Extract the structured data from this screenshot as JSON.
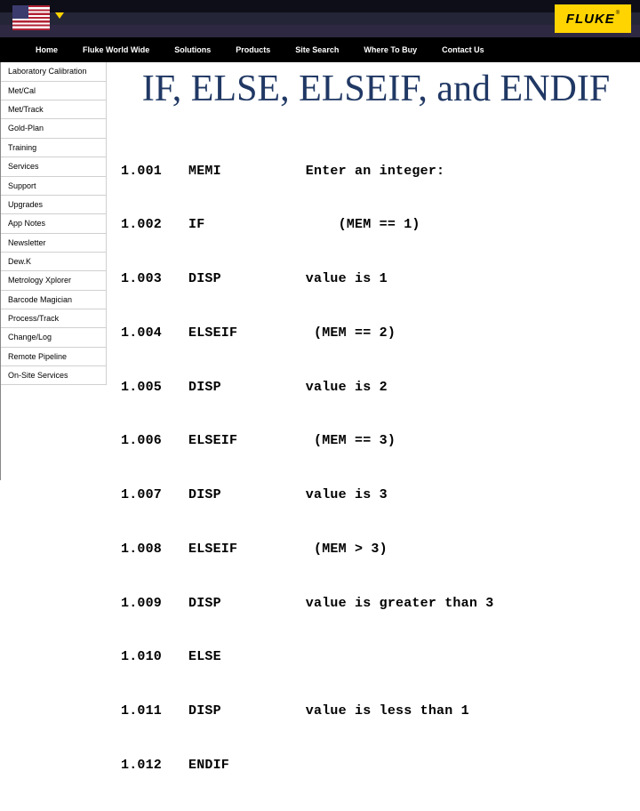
{
  "brand": "FLUKE",
  "nav": [
    "Home",
    "Fluke World Wide",
    "Solutions",
    "Products",
    "Site Search",
    "Where To Buy",
    "Contact Us"
  ],
  "sidebar": [
    "Laboratory Calibration",
    "Met/Cal",
    "Met/Track",
    "Gold-Plan",
    "Training",
    "Services",
    "Support",
    "Upgrades",
    "App Notes",
    "Newsletter",
    "Dew.K",
    "Metrology Xplorer",
    "Barcode Magician",
    "Process/Track",
    "Change/Log",
    "Remote Pipeline",
    "On-Site Services"
  ],
  "title": "IF, ELSE, ELSEIF, and ENDIF",
  "code": [
    {
      "n": "1.001",
      "op": "MEMI",
      "arg": "    Enter an integer:"
    },
    {
      "n": "1.002",
      "op": "IF",
      "arg": "        (MEM == 1)"
    },
    {
      "n": "1.003",
      "op": "DISP",
      "arg": "    value is 1"
    },
    {
      "n": "1.004",
      "op": "ELSEIF",
      "arg": "     (MEM == 2)"
    },
    {
      "n": "1.005",
      "op": "DISP",
      "arg": "    value is 2"
    },
    {
      "n": "1.006",
      "op": "ELSEIF",
      "arg": "     (MEM == 3)"
    },
    {
      "n": "1.007",
      "op": "DISP",
      "arg": "    value is 3"
    },
    {
      "n": "1.008",
      "op": "ELSEIF",
      "arg": "     (MEM > 3)"
    },
    {
      "n": "1.009",
      "op": "DISP",
      "arg": "    value is greater than 3"
    },
    {
      "n": "1.010",
      "op": "ELSE",
      "arg": ""
    },
    {
      "n": "1.011",
      "op": "DISP",
      "arg": "    value is less than 1"
    },
    {
      "n": "1.012",
      "op": "ENDIF",
      "arg": ""
    }
  ]
}
